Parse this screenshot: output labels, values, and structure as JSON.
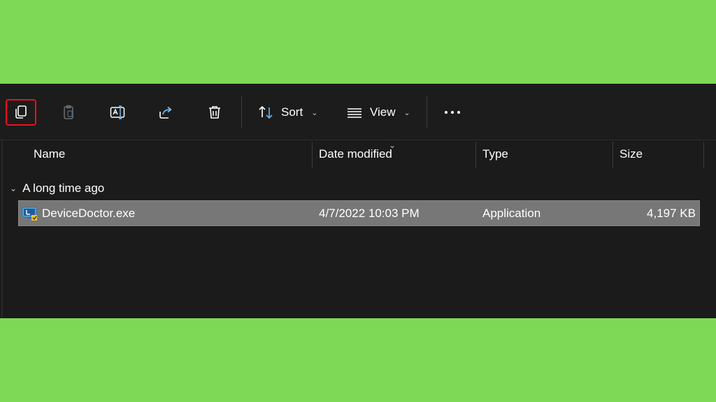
{
  "toolbar": {
    "buttons": [
      {
        "name": "copy",
        "icon": "copy-icon"
      },
      {
        "name": "paste",
        "icon": "clipboard-icon"
      },
      {
        "name": "rename",
        "icon": "rename-icon"
      },
      {
        "name": "share",
        "icon": "share-icon"
      },
      {
        "name": "delete",
        "icon": "trash-icon"
      }
    ],
    "sort_label": "Sort",
    "view_label": "View",
    "highlight_color": "#e81123"
  },
  "columns": {
    "name": "Name",
    "date_modified": "Date modified",
    "type": "Type",
    "size": "Size"
  },
  "group": {
    "label": "A long time ago"
  },
  "files": [
    {
      "name": "DeviceDoctor.exe",
      "date_modified": "4/7/2022 10:03 PM",
      "type": "Application",
      "size": "4,197 KB",
      "icon": "application-icon"
    }
  ],
  "colors": {
    "background": "#7ed957",
    "window": "#1b1b1b",
    "selected_row": "#777777"
  }
}
